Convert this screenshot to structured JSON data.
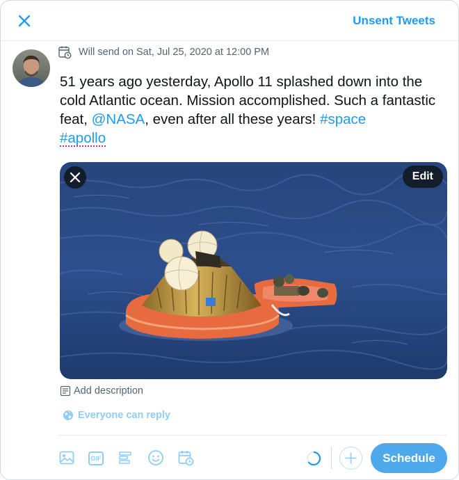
{
  "header": {
    "close_icon": "close-icon",
    "unsent_tweets_label": "Unsent Tweets"
  },
  "compose": {
    "avatar": "user-avatar",
    "scheduled_text": "Will send on Sat, Jul 25, 2020 at 12:00 PM",
    "tweet": {
      "part1": "51 years ago yesterday, Apollo 11 splashed down into the cold Atlantic ocean. Mission accomplished. Such a fantastic feat, ",
      "mention": "@NASA",
      "part2": ", even after all these years! ",
      "hashtag1": "#space",
      "hashtag2": "#apollo"
    },
    "media": {
      "description": "Apollo 11 command module floating in the ocean with flotation balloons and a life raft with crew",
      "edit_label": "Edit"
    },
    "add_description_label": "Add description",
    "reply_setting_label": "Everyone can reply"
  },
  "toolbar": {
    "icons": [
      "media-icon",
      "gif-icon",
      "poll-icon",
      "emoji-icon",
      "schedule-icon"
    ],
    "gif_label": "GIF",
    "schedule_button_label": "Schedule"
  },
  "colors": {
    "accent": "#1d9bf0",
    "accent_light": "#8ecdf8",
    "button": "#4da8ec"
  }
}
